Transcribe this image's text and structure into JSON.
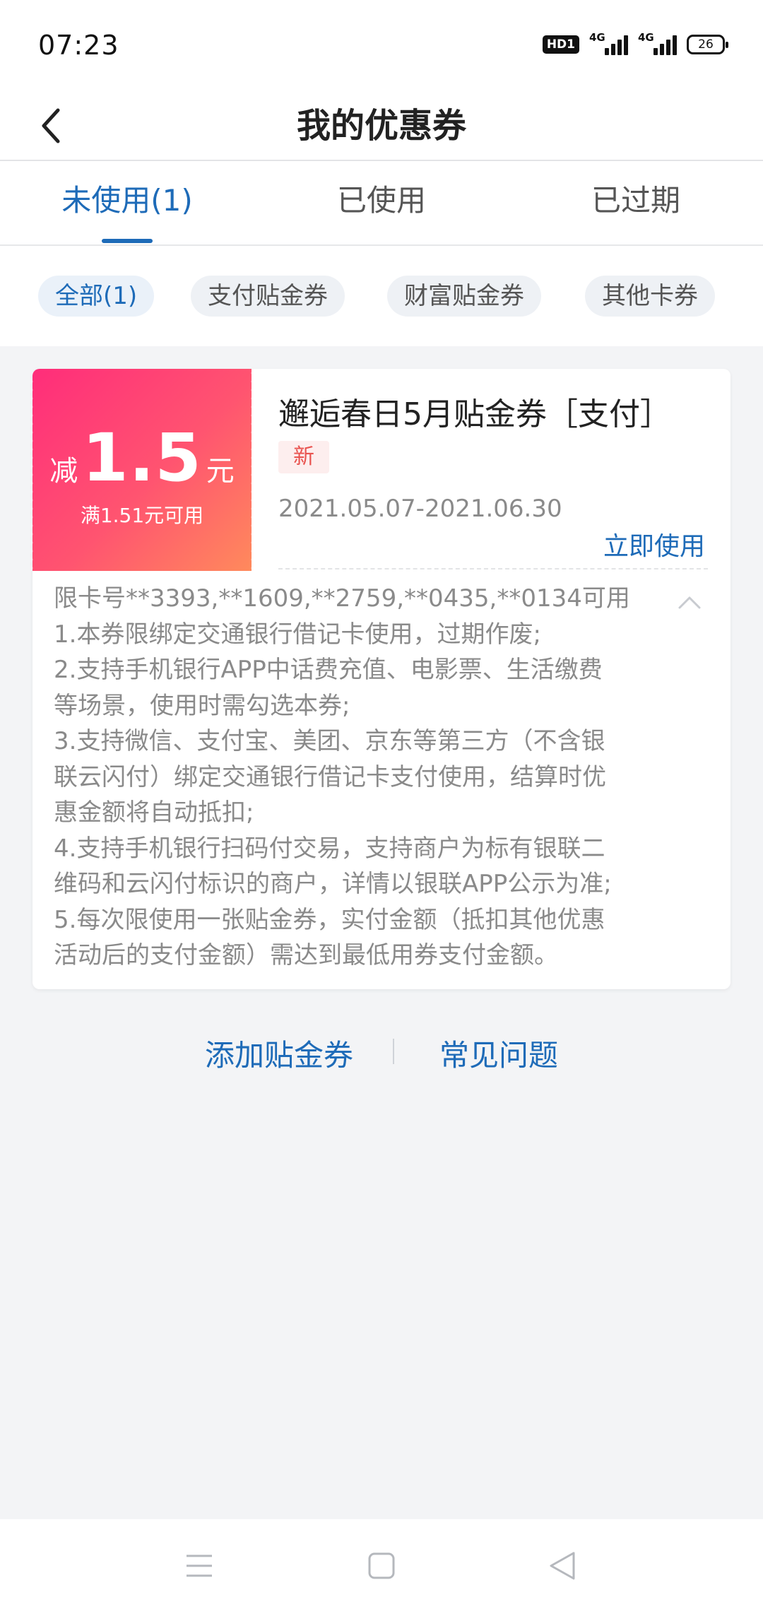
{
  "status_bar": {
    "time": "07:23",
    "hd_label": "HD1",
    "signal1_label": "4G",
    "signal2_label": "4G",
    "battery": "26"
  },
  "header": {
    "title": "我的优惠券",
    "back_icon": "chevron-left-icon"
  },
  "tabs": [
    {
      "label": "未使用(1)",
      "active": true
    },
    {
      "label": "已使用",
      "active": false
    },
    {
      "label": "已过期",
      "active": false
    }
  ],
  "filters": [
    {
      "label": "全部(1)",
      "active": true
    },
    {
      "label": "支付贴金券",
      "active": false
    },
    {
      "label": "财富贴金券",
      "active": false
    },
    {
      "label": "其他卡券",
      "active": false
    }
  ],
  "coupon": {
    "prefix": "减",
    "amount": "1.5",
    "unit": "元",
    "condition": "满1.51元可用",
    "title": "邂逅春日5月贴金券［支付］",
    "badge": "新",
    "validity": "2021.05.07-2021.06.30",
    "use_now": "立即使用",
    "details": [
      "限卡号**3393,**1609,**2759,**0435,**0134可用",
      "1.本券限绑定交通银行借记卡使用，过期作废;",
      "2.支持手机银行APP中话费充值、电影票、生活缴费",
      "等场景，使用时需勾选本券;",
      "3.支持微信、支付宝、美团、京东等第三方（不含银",
      "联云闪付）绑定交通银行借记卡支付使用，结算时优",
      "惠金额将自动抵扣;",
      "4.支持手机银行扫码付交易，支持商户为标有银联二",
      "维码和云闪付标识的商户，详情以银联APP公示为准;",
      "5.每次限使用一张贴金券，实付金额（抵扣其他优惠",
      "活动后的支付金额）需达到最低用券支付金额。"
    ],
    "gradient_start": "#ff2d7a",
    "gradient_end": "#ff8a5c"
  },
  "bottom_links": {
    "add": "添加贴金券",
    "faq": "常见问题"
  },
  "colors": {
    "accent": "#1e6bb8",
    "background": "#f3f4f6"
  }
}
